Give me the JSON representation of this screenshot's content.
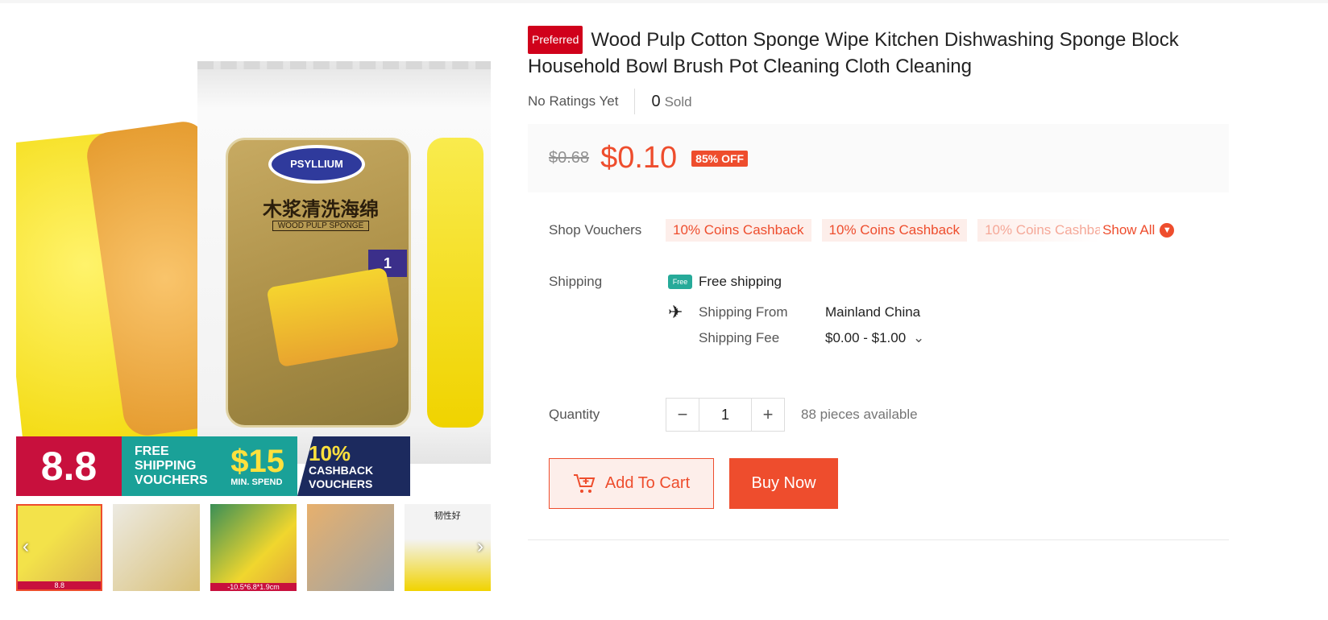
{
  "product": {
    "badge": "Preferred",
    "title": "Wood Pulp Cotton Sponge Wipe Kitchen Dishwashing Sponge Block Household Bowl Brush Pot Cleaning Cloth Cleaning",
    "ratings_text": "No Ratings Yet",
    "sold_count": "0",
    "sold_label": "Sold",
    "old_price": "$0.68",
    "new_price": "$0.10",
    "discount": "85% OFF"
  },
  "image": {
    "pkg_brand": "PSYLLIUM",
    "pkg_title": "木浆清洗海绵",
    "pkg_subtitle": "WOOD PULP SPONGE",
    "pkg_pcs": "1"
  },
  "promo": {
    "event": "8.8",
    "free_shipping": "FREE SHIPPING VOUCHERS",
    "amount": "$15",
    "min_spend": "MIN. SPEND",
    "cashback_pct": "10%",
    "cashback": "CASHBACK VOUCHERS"
  },
  "vouchers": {
    "label": "Shop Vouchers",
    "chips": [
      "10% Coins Cashback",
      "10% Coins Cashback",
      "10% Coins Cashback"
    ],
    "show_all": "Show All"
  },
  "shipping": {
    "label": "Shipping",
    "free_text": "Free shipping",
    "free_icon_text": "Free",
    "from_label": "Shipping From",
    "from_value": "Mainland China",
    "fee_label": "Shipping Fee",
    "fee_value": "$0.00 - $1.00"
  },
  "quantity": {
    "label": "Quantity",
    "value": "1",
    "available": "88 pieces available"
  },
  "actions": {
    "add_to_cart": "Add To Cart",
    "buy_now": "Buy Now"
  },
  "thumbnails": {
    "t1_label": "8.8",
    "t3_label": "-10.5*6.8*1.9cm",
    "t5_text": "韧性好"
  }
}
